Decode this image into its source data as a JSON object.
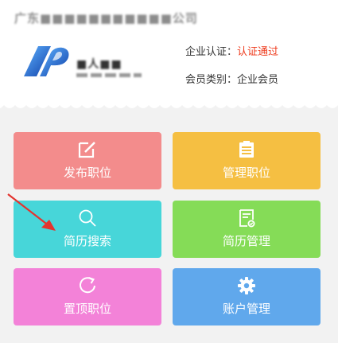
{
  "company": {
    "name": "广东■■■■■■■■■■■公司",
    "logo_text": "■人■■"
  },
  "meta": {
    "cert_label": "企业认证：",
    "cert_value": "认证通过",
    "member_label": "会员类别：",
    "member_value": "企业会员"
  },
  "colors": {
    "cert_ok": "#ee3a1c",
    "publish": "#f38c8c",
    "manage": "#f5bf42",
    "search": "#47d6d9",
    "resume": "#85dc57",
    "top": "#f382d8",
    "account": "#60a8ec",
    "arrow": "#e3342f"
  },
  "tiles": [
    {
      "label": "发布职位",
      "icon": "edit-icon",
      "color": "#f38c8c"
    },
    {
      "label": "管理职位",
      "icon": "list-doc-icon",
      "color": "#f5bf42"
    },
    {
      "label": "简历搜索",
      "icon": "search-icon",
      "color": "#47d6d9"
    },
    {
      "label": "简历管理",
      "icon": "resume-doc-icon",
      "color": "#85dc57"
    },
    {
      "label": "置顶职位",
      "icon": "refresh-icon",
      "color": "#f382d8"
    },
    {
      "label": "账户管理",
      "icon": "gear-icon",
      "color": "#60a8ec"
    }
  ]
}
